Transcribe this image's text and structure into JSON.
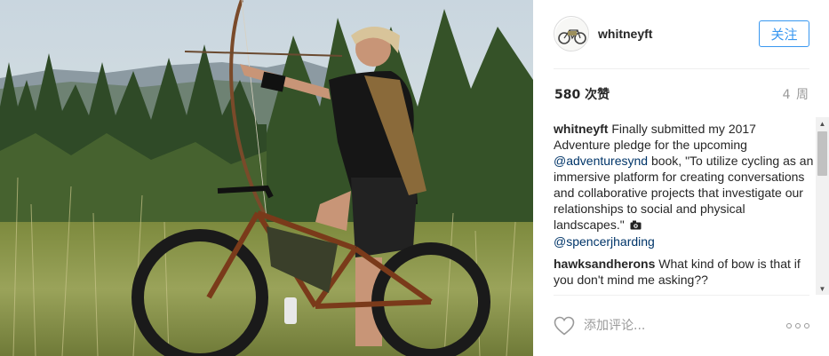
{
  "post": {
    "username": "whitneyft",
    "follow_label": "关注",
    "likes": "580 次赞",
    "age": "4 周"
  },
  "comments": [
    {
      "author": "whitneyft",
      "text_1": " Finally submitted my 2017 Adventure pledge for the upcoming ",
      "mention_1": "@adventuresynd",
      "text_2": " book, \"To utilize cycling as an immersive platform for creating conversations and collaborative projects that investigate our relationships to social and physical landscapes.\"",
      "mention_2": "@spencerjharding"
    },
    {
      "author": "hawksandherons",
      "text_1": " What kind of bow is that if you don't mind me asking??"
    }
  ],
  "comment_box": {
    "placeholder": "添加评论..."
  },
  "icons": {
    "like": "heart-outline-icon",
    "more": "more-options-icon",
    "camera": "camera-emoji-icon"
  },
  "colors": {
    "accent": "#3897f0",
    "mention": "#003569",
    "muted": "#999999",
    "divider": "#efefef"
  }
}
